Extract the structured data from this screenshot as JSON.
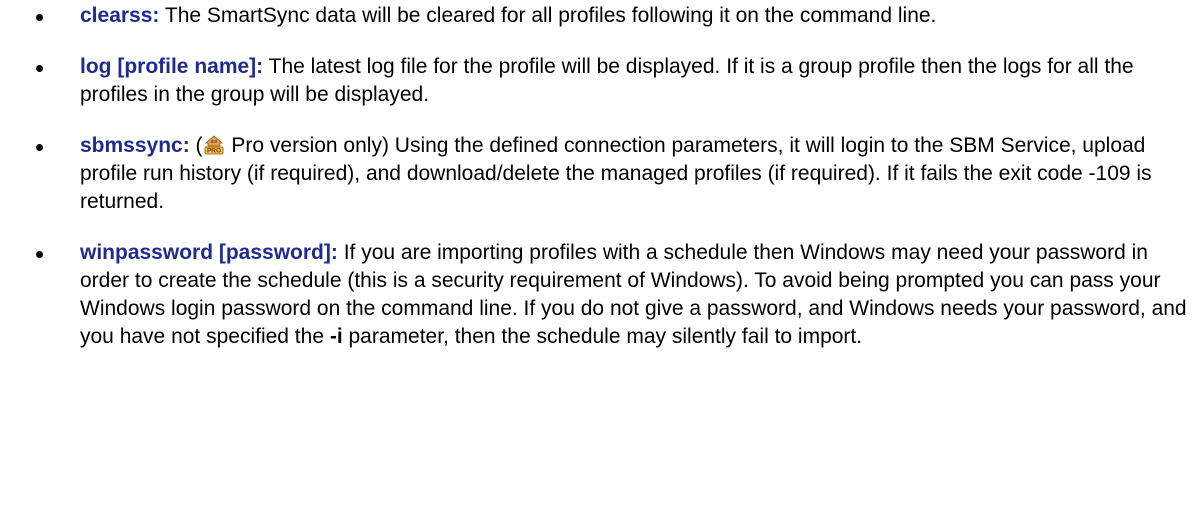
{
  "colors": {
    "term": "#1f2b8f",
    "text": "#000000",
    "background": "#ffffff"
  },
  "items": [
    {
      "term": "clearss:",
      "text": " The SmartSync data will be cleared for all profiles following it on the command line."
    },
    {
      "term": "log [profile name]:",
      "text": " The latest log file for the profile will be displayed. If it is a group profile then the logs for all the profiles in the group will be displayed."
    },
    {
      "term": "sbmssync:",
      "text_before_icon": " (",
      "icon": "pro-version-icon",
      "text_after_icon": " Pro version only) Using the defined connection parameters, it will login to the SBM Service, upload profile run history (if required), and download/delete the managed profiles (if required). If it fails the exit code -109 is returned."
    },
    {
      "term": "winpassword [password]:",
      "text_before_bold": " If you are importing profiles with a schedule then Windows may need your password in order to create the schedule (this is a security requirement of Windows). To avoid being prompted you can pass your Windows login password on the command line. If you do not give a password, and Windows needs your password, and you have not specified the ",
      "bold": "-i",
      "text_after_bold": " parameter, then the schedule may silently fail to import."
    }
  ]
}
